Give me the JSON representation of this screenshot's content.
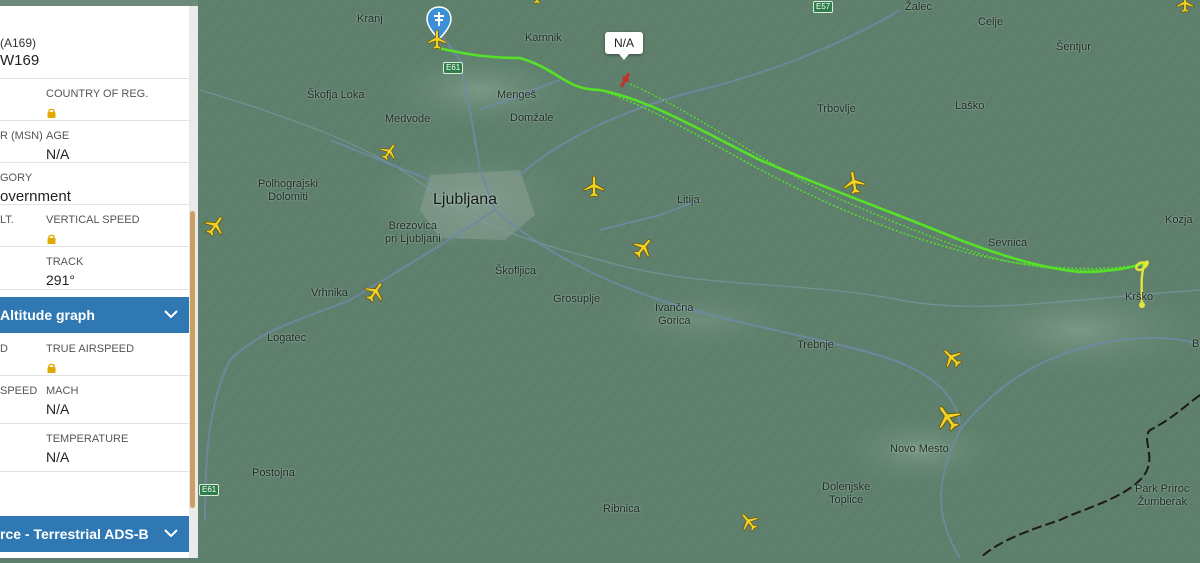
{
  "map": {
    "cities": [
      {
        "id": "kranj",
        "label": "Kranj"
      },
      {
        "id": "kamnik",
        "label": "Kamnik"
      },
      {
        "id": "zalec",
        "label": "Žalec"
      },
      {
        "id": "celje",
        "label": "Celje"
      },
      {
        "id": "sentjur",
        "label": "Šentjur"
      },
      {
        "id": "skofja-loka",
        "label": "Škofja Loka"
      },
      {
        "id": "menges",
        "label": "Mengeš"
      },
      {
        "id": "domzale",
        "label": "Domžale"
      },
      {
        "id": "trbovlje",
        "label": "Trbovlje"
      },
      {
        "id": "lasko",
        "label": "Laško"
      },
      {
        "id": "medvode",
        "label": "Medvode"
      },
      {
        "id": "polhograjski",
        "label": "Polhograjski\nDolomiti"
      },
      {
        "id": "ljubljana",
        "label": "Ljubljana"
      },
      {
        "id": "litija",
        "label": "Litija"
      },
      {
        "id": "brezovica",
        "label": "Brezovica\npri Ljubljani"
      },
      {
        "id": "sevnica",
        "label": "Sevnica"
      },
      {
        "id": "kozjansko",
        "label": "Kozja"
      },
      {
        "id": "vrhnika",
        "label": "Vrhnika"
      },
      {
        "id": "skofljica",
        "label": "Škofljica"
      },
      {
        "id": "grosuplje",
        "label": "Grosuplje"
      },
      {
        "id": "ivancna-gorica",
        "label": "Ivančna\nGorica"
      },
      {
        "id": "krsko",
        "label": "Krško"
      },
      {
        "id": "logatec",
        "label": "Logatec"
      },
      {
        "id": "trebnje",
        "label": "Trebnje"
      },
      {
        "id": "novo-mesto",
        "label": "Novo Mesto"
      },
      {
        "id": "postojna",
        "label": "Postojna"
      },
      {
        "id": "dolenjske-toplice",
        "label": "Dolenjske\nToplice"
      },
      {
        "id": "ribnica",
        "label": "Ribnica"
      },
      {
        "id": "park-zumberak",
        "label": "Park Priroc\nŽumberak"
      },
      {
        "id": "edge-b",
        "label": "B"
      }
    ],
    "road_badges": [
      {
        "id": "e61",
        "label": "E61"
      },
      {
        "id": "e57",
        "label": "E57"
      },
      {
        "id": "e61b",
        "label": "E61"
      }
    ],
    "aircraft_callout": "N/A",
    "colors": {
      "terrain": "#5d7f6d",
      "track": "#57e02a",
      "track_end": "#e3e63a",
      "plane": "#f2d226",
      "roads": "#6f8aa6"
    }
  },
  "panel": {
    "header_reg_partial": "(A169)",
    "header_callsign_partial": "W169",
    "rows": [
      {
        "left_label": "",
        "right_label": "COUNTRY OF REG.",
        "right_value": "",
        "locked": true
      },
      {
        "left_label": "R (MSN)",
        "right_label": "AGE",
        "right_value": "N/A",
        "locked": false
      },
      {
        "left_label": "GORY",
        "right_label": "",
        "right_value": "",
        "left_value": "overnment",
        "locked": false
      },
      {
        "left_label": "LT.",
        "right_label": "VERTICAL SPEED",
        "right_value": "",
        "locked": true
      },
      {
        "left_label": "",
        "right_label": "TRACK",
        "right_value": "291°",
        "locked": false
      }
    ],
    "altitude_section": "Altitude graph",
    "rows2": [
      {
        "left_label": "D",
        "right_label": "TRUE AIRSPEED",
        "right_value": "",
        "locked": true
      },
      {
        "left_label": "SPEED",
        "right_label": "MACH",
        "right_value": "N/A",
        "locked": false
      },
      {
        "left_label": "",
        "right_label": "TEMPERATURE",
        "right_value": "N/A",
        "locked": false
      }
    ],
    "source_section": "rce - Terrestrial ADS-B"
  }
}
